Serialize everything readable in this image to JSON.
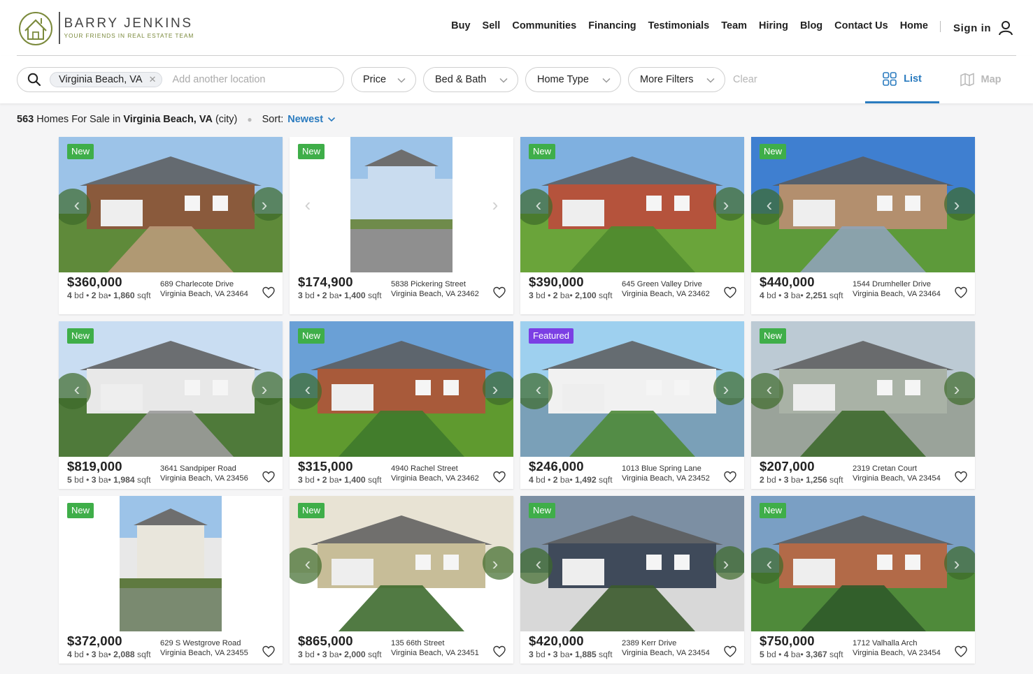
{
  "brand": {
    "name": "BARRY JENKINS",
    "tagline": "YOUR FRIENDS IN REAL ESTATE TEAM"
  },
  "nav": [
    "Buy",
    "Sell",
    "Communities",
    "Financing",
    "Testimonials",
    "Team",
    "Hiring",
    "Blog",
    "Contact Us",
    "Home"
  ],
  "signin": "Sign in",
  "search": {
    "chip": "Virginia Beach, VA",
    "placeholder": "Add another location"
  },
  "filters": {
    "price": "Price",
    "bedbath": "Bed & Bath",
    "hometype": "Home Type",
    "more": "More Filters",
    "clear": "Clear"
  },
  "views": {
    "list": "List",
    "map": "Map"
  },
  "results": {
    "count": "563",
    "label": "Homes For Sale in",
    "location": "Virginia Beach, VA",
    "suffix": "(city)",
    "sort_label": "Sort:",
    "sort_value": "Newest"
  },
  "colors": {
    "accent": "#2a7bbf",
    "new_badge": "#3fae49",
    "featured_badge": "#7b3fe4",
    "logo_green": "#7b8a3c"
  },
  "listings": [
    {
      "badge": "New",
      "price": "$360,000",
      "bd": "4",
      "ba": "2",
      "sqft": "1,860",
      "street": "689 Charlecote Drive",
      "city": "Virginia Beach, VA 23464"
    },
    {
      "badge": "New",
      "price": "$174,900",
      "bd": "3",
      "ba": "2",
      "sqft": "1,400",
      "street": "5838 Pickering Street",
      "city": "Virginia Beach, VA 23462"
    },
    {
      "badge": "New",
      "price": "$390,000",
      "bd": "3",
      "ba": "2",
      "sqft": "2,100",
      "street": "645 Green Valley Drive",
      "city": "Virginia Beach, VA 23462"
    },
    {
      "badge": "New",
      "price": "$440,000",
      "bd": "4",
      "ba": "3",
      "sqft": "2,251",
      "street": "1544 Drumheller Drive",
      "city": "Virginia Beach, VA 23464"
    },
    {
      "badge": "New",
      "price": "$819,000",
      "bd": "5",
      "ba": "3",
      "sqft": "1,984",
      "street": "3641 Sandpiper Road",
      "city": "Virginia Beach, VA 23456"
    },
    {
      "badge": "New",
      "price": "$315,000",
      "bd": "3",
      "ba": "2",
      "sqft": "1,400",
      "street": "4940 Rachel Street",
      "city": "Virginia Beach, VA 23462"
    },
    {
      "badge": "Featured",
      "price": "$246,000",
      "bd": "4",
      "ba": "2",
      "sqft": "1,492",
      "street": "1013 Blue Spring Lane",
      "city": "Virginia Beach, VA 23452"
    },
    {
      "badge": "New",
      "price": "$207,000",
      "bd": "2",
      "ba": "3",
      "sqft": "1,256",
      "street": "2319 Cretan Court",
      "city": "Virginia Beach, VA 23454"
    },
    {
      "badge": "New",
      "price": "$372,000",
      "bd": "4",
      "ba": "3",
      "sqft": "2,088",
      "street": "629 S Westgrove Road",
      "city": "Virginia Beach, VA 23455"
    },
    {
      "badge": "New",
      "price": "$865,000",
      "bd": "3",
      "ba": "3",
      "sqft": "2,000",
      "street": "135 66th Street",
      "city": "Virginia Beach, VA 23451"
    },
    {
      "badge": "New",
      "price": "$420,000",
      "bd": "3",
      "ba": "3",
      "sqft": "1,885",
      "street": "2389 Kerr Drive",
      "city": "Virginia Beach, VA 23454"
    },
    {
      "badge": "New",
      "price": "$750,000",
      "bd": "5",
      "ba": "4",
      "sqft": "3,367",
      "street": "1712 Valhalla Arch",
      "city": "Virginia Beach, VA 23454"
    }
  ]
}
